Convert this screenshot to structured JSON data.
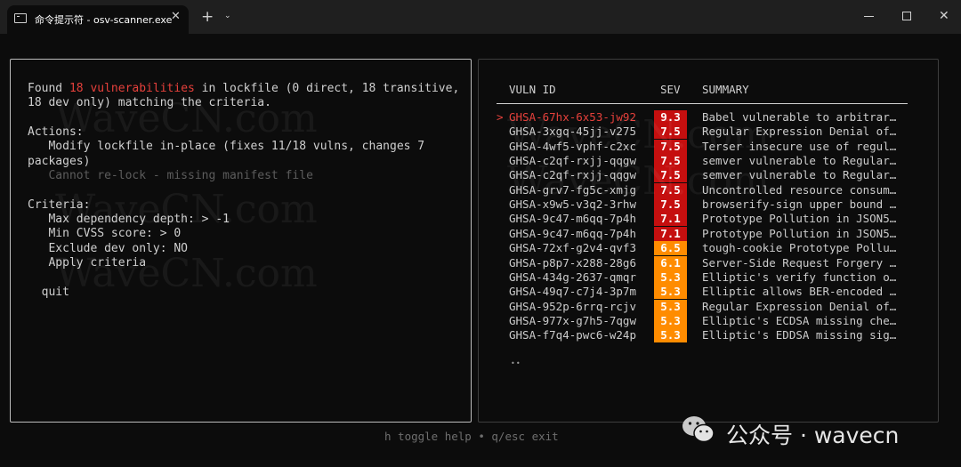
{
  "window": {
    "tab_title": "命令提示符 - osv-scanner.exe",
    "close_tab_glyph": "✕",
    "new_tab_glyph": "+",
    "dropdown_glyph": "⌄",
    "close_window_glyph": "✕"
  },
  "left": {
    "found_prefix": "Found ",
    "found_count": "18 vulnerabilities",
    "found_suffix": " in lockfile (0 direct, 18 transitive,",
    "found_line2": "18 dev only) matching the criteria.",
    "actions_heading": "Actions:",
    "action_modify_line1": "   Modify lockfile in-place (fixes 11/18 vulns, changes 7",
    "action_modify_line2": "packages)",
    "action_relock": "   Cannot re-lock - missing manifest file",
    "criteria_heading": "Criteria:",
    "criteria": [
      "   Max dependency depth: > -1",
      "   Min CVSS score: > 0",
      "   Exclude dev only: NO",
      "   Apply criteria"
    ],
    "quit": "  quit"
  },
  "table": {
    "headers": {
      "id": "VULN ID",
      "sev": "SEV",
      "summary": "SUMMARY"
    },
    "cursor": ">",
    "rows": [
      {
        "id": "GHSA-67hx-6x53-jw92",
        "sev": "9.3",
        "summary": "Babel vulnerable to arbitrar…"
      },
      {
        "id": "GHSA-3xgq-45jj-v275",
        "sev": "7.5",
        "summary": "Regular Expression Denial of…"
      },
      {
        "id": "GHSA-4wf5-vphf-c2xc",
        "sev": "7.5",
        "summary": "Terser insecure use of regul…"
      },
      {
        "id": "GHSA-c2qf-rxjj-qqgw",
        "sev": "7.5",
        "summary": "semver vulnerable to Regular…"
      },
      {
        "id": "GHSA-c2qf-rxjj-qqgw",
        "sev": "7.5",
        "summary": "semver vulnerable to Regular…"
      },
      {
        "id": "GHSA-grv7-fg5c-xmjg",
        "sev": "7.5",
        "summary": "Uncontrolled resource consum…"
      },
      {
        "id": "GHSA-x9w5-v3q2-3rhw",
        "sev": "7.5",
        "summary": "browserify-sign upper bound …"
      },
      {
        "id": "GHSA-9c47-m6qq-7p4h",
        "sev": "7.1",
        "summary": "Prototype Pollution in JSON5…"
      },
      {
        "id": "GHSA-9c47-m6qq-7p4h",
        "sev": "7.1",
        "summary": "Prototype Pollution in JSON5…"
      },
      {
        "id": "GHSA-72xf-g2v4-qvf3",
        "sev": "6.5",
        "summary": "tough-cookie Prototype Pollu…"
      },
      {
        "id": "GHSA-p8p7-x288-28g6",
        "sev": "6.1",
        "summary": "Server-Side Request Forgery …"
      },
      {
        "id": "GHSA-434g-2637-qmqr",
        "sev": "5.3",
        "summary": "Elliptic's verify function o…"
      },
      {
        "id": "GHSA-49q7-c7j4-3p7m",
        "sev": "5.3",
        "summary": "Elliptic allows BER-encoded …"
      },
      {
        "id": "GHSA-952p-6rrq-rcjv",
        "sev": "5.3",
        "summary": "Regular Expression Denial of…"
      },
      {
        "id": "GHSA-977x-g7h5-7qgw",
        "sev": "5.3",
        "summary": "Elliptic's ECDSA missing che…"
      },
      {
        "id": "GHSA-f7q4-pwc6-w24p",
        "sev": "5.3",
        "summary": "Elliptic's EDDSA missing sig…"
      }
    ],
    "pager": "••"
  },
  "footer": {
    "help": "h toggle help • q/esc exit"
  },
  "watermark": {
    "text": "WaveCN.com",
    "brand": "公众号 · wavecn"
  },
  "colors": {
    "critical": "#c50f0f",
    "high": "#c50f0f",
    "medium": "#ff8c00",
    "highlight": "#e5403b"
  }
}
